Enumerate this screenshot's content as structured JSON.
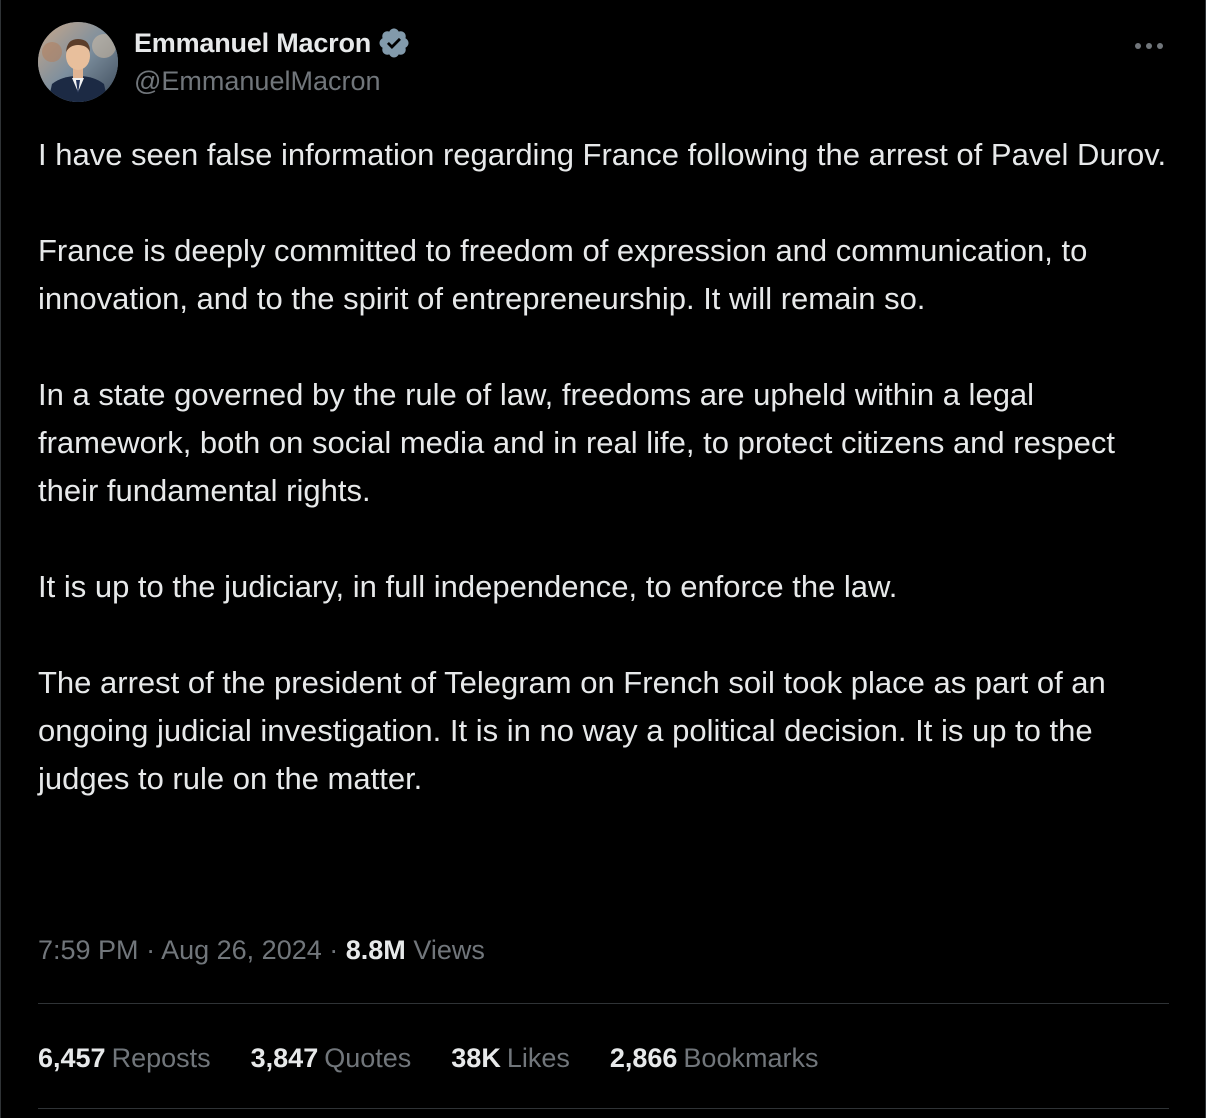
{
  "author": {
    "display_name": "Emmanuel Macron",
    "handle": "@EmmanuelMacron",
    "verified": true,
    "verified_color": "#829aab"
  },
  "tweet": {
    "paragraphs": [
      "I have seen false information regarding France following the arrest of Pavel Durov.",
      "France is deeply committed to freedom of expression and communication, to innovation, and to the spirit of entrepreneurship. It will remain so.",
      "In a state governed by the rule of law, freedoms are upheld within a legal framework, both on social media and in real life, to protect citizens and respect their fundamental rights.",
      "It is up to the judiciary, in full independence, to enforce the law.",
      "The arrest of the president of Telegram on French soil took place as part of an ongoing judicial investigation. It is in no way a political decision. It is up to the judges to rule on the matter."
    ]
  },
  "meta": {
    "time": "7:59 PM",
    "separator": "·",
    "date": "Aug 26, 2024",
    "views_count": "8.8M",
    "views_label": "Views"
  },
  "stats": {
    "reposts": {
      "count": "6,457",
      "label": "Reposts"
    },
    "quotes": {
      "count": "3,847",
      "label": "Quotes"
    },
    "likes": {
      "count": "38K",
      "label": "Likes"
    },
    "bookmarks": {
      "count": "2,866",
      "label": "Bookmarks"
    }
  },
  "colors": {
    "background": "#000000",
    "text_primary": "#e7e9ea",
    "text_secondary": "#71767b",
    "divider": "#2f3336"
  },
  "icons": {
    "verified": "verified-badge-icon",
    "more": "more-horizontal-icon"
  }
}
